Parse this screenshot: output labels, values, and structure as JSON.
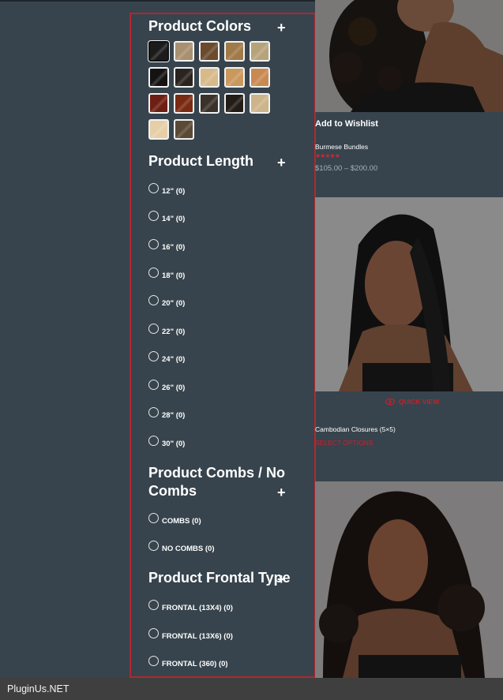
{
  "filters": {
    "colors": {
      "title": "Product Colors",
      "swatches": [
        {
          "icon": "swatch-off-black",
          "color": "#1b1b1b"
        },
        {
          "icon": "swatch-ash-blonde",
          "color": "#a89070"
        },
        {
          "icon": "swatch-chestnut",
          "color": "#6b4a2e"
        },
        {
          "icon": "swatch-honey",
          "color": "#a07a48"
        },
        {
          "icon": "swatch-sand",
          "color": "#b7a37a"
        },
        {
          "icon": "swatch-jet-black",
          "color": "#151312"
        },
        {
          "icon": "swatch-dark-brown",
          "color": "#2a2320"
        },
        {
          "icon": "swatch-light-blonde",
          "color": "#d8b98a"
        },
        {
          "icon": "swatch-golden-blonde",
          "color": "#c9985c"
        },
        {
          "icon": "swatch-caramel",
          "color": "#c98a52"
        },
        {
          "icon": "swatch-burgundy",
          "color": "#6e1e12"
        },
        {
          "icon": "swatch-auburn",
          "color": "#7a2a12"
        },
        {
          "icon": "swatch-dark-ash",
          "color": "#3a322a"
        },
        {
          "icon": "swatch-espresso",
          "color": "#221b16"
        },
        {
          "icon": "swatch-pale-blonde",
          "color": "#cdb48a"
        },
        {
          "icon": "swatch-platinum",
          "color": "#e6cfa6"
        },
        {
          "icon": "swatch-ombre",
          "color": "#5a4a35"
        }
      ]
    },
    "length": {
      "title": "Product Length",
      "options": [
        "12\" (0)",
        "14\" (0)",
        "16\" (0)",
        "18\" (0)",
        "20\" (0)",
        "22\" (0)",
        "24\" (0)",
        "26\" (0)",
        "28\" (0)",
        "30\" (0)"
      ]
    },
    "combs": {
      "title_line1": "Product Combs / No",
      "title_line2": "Combs",
      "options": [
        "COMBS (0)",
        "NO COMBS (0)"
      ]
    },
    "frontal": {
      "title": "Product Frontal Type",
      "options": [
        "FRONTAL (13X4) (0)",
        "FRONTAL (13X6) (0)",
        "FRONTAL (360) (0)"
      ]
    },
    "plus_symbol": "+"
  },
  "products": {
    "p1": {
      "wishlist": "Add to Wishlist",
      "name": "Burmese Bundles",
      "stars": "★★★★★",
      "price": "$105.00 – $200.00"
    },
    "p2": {
      "quick_view": "QUICK VIEW",
      "name": "Cambodian Closures (5×5)",
      "select": "SELECT OPTIONS"
    }
  },
  "footer": {
    "brand": "PluginUs.NET"
  }
}
